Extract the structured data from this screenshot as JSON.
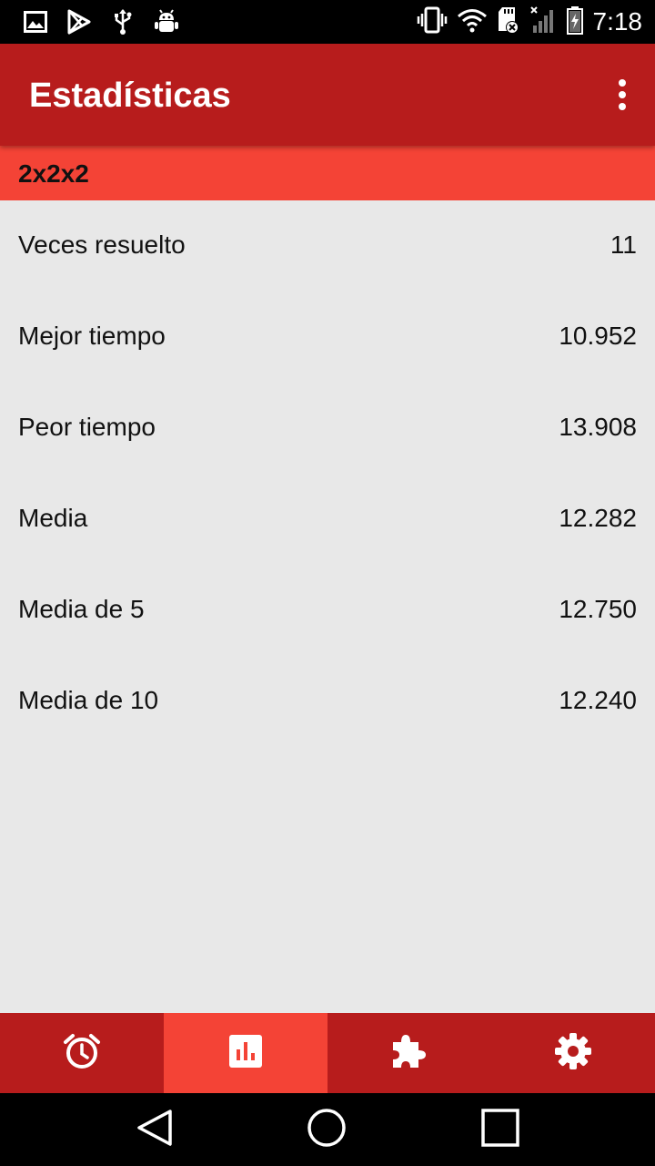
{
  "status_bar": {
    "time": "7:18",
    "left_icons": [
      "image-icon",
      "play-store-icon",
      "usb-icon",
      "android-debug-icon"
    ],
    "right_icons": [
      "vibrate-icon",
      "wifi-icon",
      "sd-card-icon",
      "cell-signal-icon",
      "battery-icon"
    ]
  },
  "app_bar": {
    "title": "Estadísticas",
    "overflow_icon": "more-vert-icon"
  },
  "section": {
    "title": "2x2x2"
  },
  "stats": [
    {
      "label": "Veces resuelto",
      "value": "11"
    },
    {
      "label": "Mejor tiempo",
      "value": "10.952"
    },
    {
      "label": "Peor tiempo",
      "value": "13.908"
    },
    {
      "label": "Media",
      "value": "12.282"
    },
    {
      "label": "Media de 5",
      "value": "12.750"
    },
    {
      "label": "Media de 10",
      "value": "12.240"
    }
  ],
  "tabs": [
    {
      "icon": "alarm-clock-icon",
      "active": false
    },
    {
      "icon": "bar-chart-icon",
      "active": true
    },
    {
      "icon": "puzzle-icon",
      "active": false
    },
    {
      "icon": "gear-icon",
      "active": false
    }
  ],
  "nav_bar": {
    "icons": [
      "back-icon",
      "home-icon",
      "recents-icon"
    ]
  },
  "colors": {
    "app_bar": "#b71c1c",
    "accent": "#f44336",
    "background": "#e8e8e8"
  }
}
